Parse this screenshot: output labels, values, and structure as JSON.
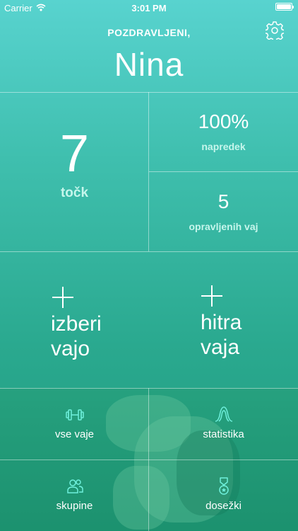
{
  "status_bar": {
    "carrier": "Carrier",
    "time": "3:01 PM"
  },
  "header": {
    "greeting": "POZDRAVLJENI,",
    "username": "Nina"
  },
  "points": {
    "value": "7",
    "label": "točk"
  },
  "progress": {
    "value": "100%",
    "label": "napredek"
  },
  "completed": {
    "value": "5",
    "label": "opravljenih vaj"
  },
  "actions": {
    "choose_exercise": "izberi\nvajo",
    "quick_exercise": "hitra\nvaja"
  },
  "nav": {
    "all_exercises": "vse vaje",
    "statistics": "statistika",
    "groups": "skupine",
    "achievements": "dosežki"
  },
  "colors": {
    "accent_light": "#c6f6ec",
    "top": "#58d3cf",
    "bottom": "#1f9a7c"
  }
}
